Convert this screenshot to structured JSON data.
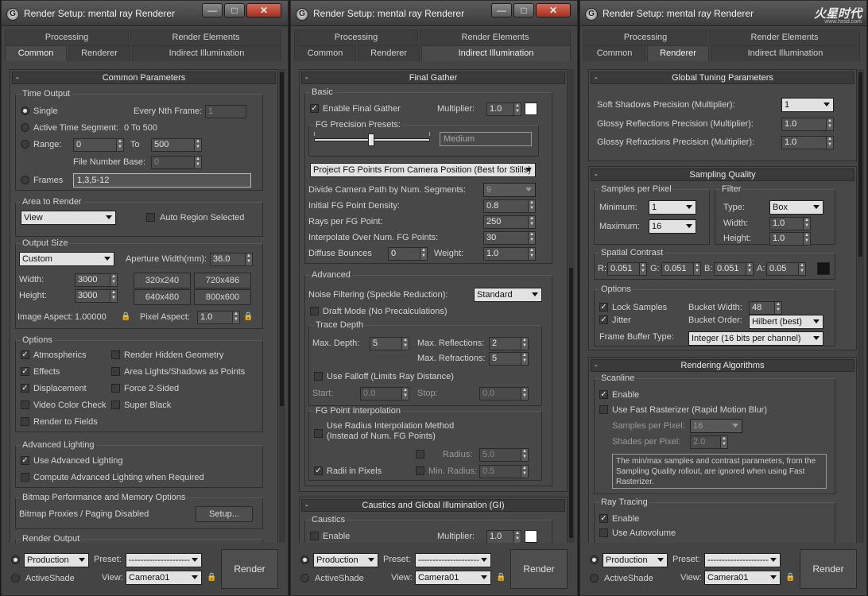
{
  "title": "Render Setup: mental ray Renderer",
  "logo": {
    "text": "火星时代",
    "sub": "www.hxsd.com"
  },
  "tabs": {
    "row1": [
      "Processing",
      "Render Elements"
    ],
    "row2": [
      "Common",
      "Renderer",
      "Indirect Illumination"
    ]
  },
  "bottom": {
    "mode_production": "Production",
    "mode_activeshade": "ActiveShade",
    "preset_label": "Preset:",
    "preset_value": "---------------------",
    "view_label": "View:",
    "view_value": "Camera01",
    "render": "Render"
  },
  "p1": {
    "rollout_title": "Common Parameters",
    "time_output": {
      "label": "Time Output",
      "single": "Single",
      "every_nth": "Every Nth Frame:",
      "every_nth_value": "1",
      "active_segment": "Active Time Segment:",
      "active_range": "0 To 500",
      "range": "Range:",
      "range_from": "0",
      "to": "To",
      "range_to": "500",
      "file_number_base": "File Number Base:",
      "fnb_value": "0",
      "frames": "Frames",
      "frames_value": "1,3,5-12"
    },
    "area": {
      "label": "Area to Render",
      "view": "View",
      "auto_region": "Auto Region Selected"
    },
    "output_size": {
      "label": "Output Size",
      "preset": "Custom",
      "aperture": "Aperture Width(mm):",
      "aperture_value": "36.0",
      "width": "Width:",
      "width_value": "3000",
      "height": "Height:",
      "height_value": "3000",
      "p1": "320x240",
      "p2": "720x486",
      "p3": "640x480",
      "p4": "800x600",
      "image_aspect": "Image Aspect:",
      "image_aspect_value": "1.00000",
      "pixel_aspect": "Pixel Aspect:",
      "pixel_aspect_value": "1.0"
    },
    "options": {
      "label": "Options",
      "atmospherics": "Atmospherics",
      "hidden_geom": "Render Hidden Geometry",
      "effects": "Effects",
      "area_lights": "Area Lights/Shadows as Points",
      "displacement": "Displacement",
      "force2": "Force 2-Sided",
      "video_color": "Video Color Check",
      "super_black": "Super Black",
      "render_fields": "Render to Fields"
    },
    "adv_lighting": {
      "label": "Advanced Lighting",
      "use": "Use Advanced Lighting",
      "compute": "Compute Advanced Lighting when Required"
    },
    "bitmap": {
      "label": "Bitmap Performance and Memory Options",
      "text": "Bitmap Proxies / Paging Disabled",
      "setup": "Setup..."
    },
    "render_output": {
      "label": "Render Output"
    }
  },
  "p2": {
    "final_gather": "Final Gather",
    "basic": {
      "label": "Basic",
      "enable": "Enable Final Gather",
      "multiplier": "Multiplier:",
      "multiplier_value": "1.0",
      "presets": "FG Precision Presets:",
      "preset_value": "Medium",
      "project_dd": "Project FG Points From Camera Position (Best for Stills)",
      "divide": "Divide Camera Path by Num. Segments:",
      "divide_value": "9",
      "initial_density": "Initial FG Point Density:",
      "initial_density_value": "0.8",
      "rays": "Rays per FG Point:",
      "rays_value": "250",
      "interpolate": "Interpolate Over Num. FG Points:",
      "interpolate_value": "30",
      "diffuse": "Diffuse Bounces",
      "diffuse_value": "0",
      "weight": "Weight:",
      "weight_value": "1.0"
    },
    "advanced": {
      "label": "Advanced",
      "noise": "Noise Filtering (Speckle Reduction):",
      "noise_value": "Standard",
      "draft": "Draft Mode (No Precalculations)"
    },
    "trace": {
      "label": "Trace Depth",
      "max_depth": "Max. Depth:",
      "max_depth_value": "5",
      "max_refl": "Max. Reflections:",
      "max_refl_value": "2",
      "max_refr": "Max. Refractions:",
      "max_refr_value": "5",
      "falloff": "Use Falloff (Limits Ray Distance)",
      "start": "Start:",
      "start_value": "0.0",
      "stop": "Stop:",
      "stop_value": "0.0"
    },
    "fgpi": {
      "label": "FG Point Interpolation",
      "radius_interp": "Use Radius Interpolation Method",
      "radius_interp2": "(Instead of Num. FG Points)",
      "radius": "Radius:",
      "radius_value": "5.0",
      "radii_pixels": "Radii in Pixels",
      "min_radius": "Min. Radius:",
      "min_radius_value": "0.5"
    },
    "caustics_gi": "Caustics and Global Illumination (GI)",
    "caustics": {
      "label": "Caustics",
      "enable": "Enable",
      "multiplier": "Multiplier:",
      "multiplier_value": "1.0"
    }
  },
  "p3": {
    "global_tuning": "Global Tuning Parameters",
    "soft_shadows": "Soft Shadows Precision (Multiplier):",
    "soft_shadows_value": "1",
    "glossy_refl": "Glossy Reflections Precision (Multiplier):",
    "glossy_refl_value": "1.0",
    "glossy_refr": "Glossy Refractions Precision (Multiplier):",
    "glossy_refr_value": "1.0",
    "sampling_quality": "Sampling Quality",
    "spp": {
      "label": "Samples per Pixel",
      "min": "Minimum:",
      "min_value": "1",
      "max": "Maximum:",
      "max_value": "16"
    },
    "filter": {
      "label": "Filter",
      "type": "Type:",
      "type_value": "Box",
      "width": "Width:",
      "width_value": "1.0",
      "height": "Height:",
      "height_value": "1.0"
    },
    "spatial": {
      "label": "Spatial Contrast",
      "r": "R:",
      "r_value": "0.051",
      "g": "G:",
      "g_value": "0.051",
      "b": "B:",
      "b_value": "0.051",
      "a": "A:",
      "a_value": "0.05"
    },
    "options": {
      "label": "Options",
      "lock": "Lock Samples",
      "bucket_width": "Bucket Width:",
      "bucket_width_value": "48",
      "jitter": "Jitter",
      "bucket_order": "Bucket Order:",
      "bucket_order_value": "Hilbert (best)",
      "fb_type": "Frame Buffer Type:",
      "fb_type_value": "Integer (16 bits per channel)"
    },
    "rendering_algorithms": "Rendering Algorithms",
    "scanline": {
      "label": "Scanline",
      "enable": "Enable",
      "fast": "Use Fast Rasterizer (Rapid Motion Blur)",
      "spp": "Samples per Pixel:",
      "spp_value": "16",
      "spp2": "Shades per Pixel:",
      "spp2_value": "2.0",
      "note": "The min/max samples and contrast parameters, from the Sampling Quality rollout, are ignored when using Fast Rasterizer."
    },
    "ray_tracing": {
      "label": "Ray Tracing",
      "enable": "Enable",
      "autovolume": "Use Autovolume"
    }
  }
}
